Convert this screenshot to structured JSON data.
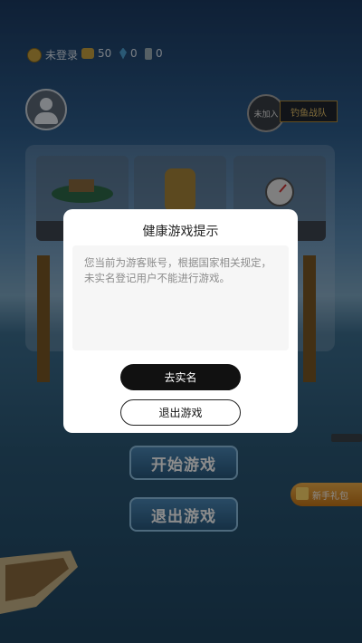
{
  "status_bar": {
    "login_status": "未登录",
    "gold_count": "50",
    "gem_count": "0",
    "bottle_count": "0"
  },
  "team": {
    "badge_text": "未加入",
    "tag_text": "钓鱼战队"
  },
  "main_buttons": {
    "start": "开始游戏",
    "quit": "退出游戏"
  },
  "gift": {
    "label": "新手礼包"
  },
  "modal": {
    "title": "健康游戏提示",
    "message": "您当前为游客账号，根据国家相关规定，未实名登记用户不能进行游戏。",
    "primary_button": "去实名",
    "secondary_button": "退出游戏"
  },
  "colors": {
    "modal_bg": "#ffffff",
    "primary_button_bg": "#111111",
    "gold": "#c9a241",
    "game_button": "#29597e"
  }
}
